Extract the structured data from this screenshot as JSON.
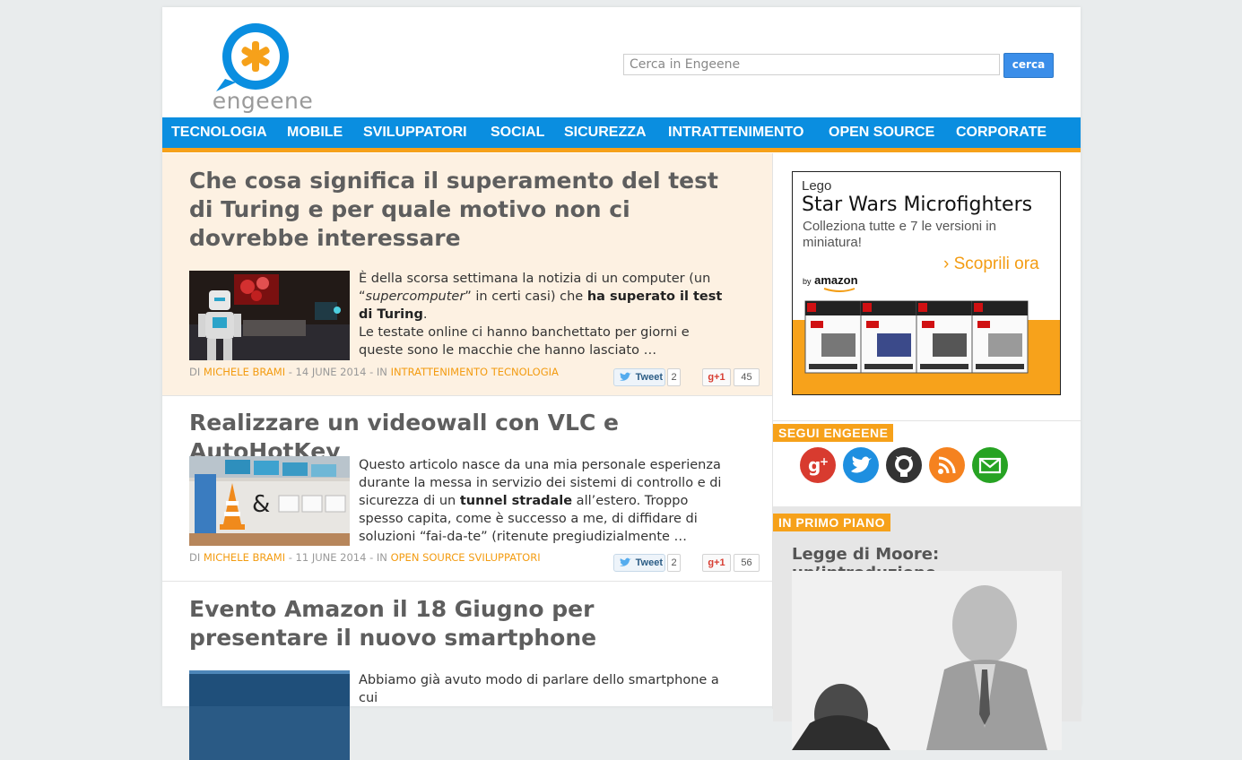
{
  "brand": {
    "name": "engeene",
    "accent": "#0a8ee0",
    "orange": "#f6a11a"
  },
  "search": {
    "placeholder": "Cerca in Engeene",
    "button": "cerca"
  },
  "nav": {
    "items": [
      "TECNOLOGIA",
      "MOBILE",
      "SVILUPPATORI",
      "SOCIAL",
      "SICUREZZA",
      "INTRATTENIMENTO",
      "OPEN SOURCE",
      "CORPORATE"
    ]
  },
  "articles": [
    {
      "title": "Che cosa significa il superamento del test di Turing e per quale motivo non ci dovrebbe interessare",
      "excerpt": [
        "È della scorsa settimana la notizia di un computer (un “",
        "supercomputer",
        "” in certi casi) che ",
        "ha superato il test di Turing",
        ".",
        "Le testate online ci hanno banchettato per giorni e queste sono le macchie che hanno lasciato …"
      ],
      "meta_prefix": "DI ",
      "author": "MICHELE BRAMI",
      "date": " - 14 JUNE 2014 - IN ",
      "categories": "INTRATTENIMENTO TECNOLOGIA",
      "tweet_label": "Tweet",
      "tweet_count": "2",
      "gplus_label": "+1",
      "gplus_count": "45"
    },
    {
      "title": "Realizzare un videowall con VLC e AutoHotKey",
      "excerpt": [
        "Questo articolo nasce da una mia personale esperienza durante la messa in servizio dei sistemi di controllo e di sicurezza di un ",
        "tunnel stradale",
        " all’estero. Troppo spesso capita, come è successo a me, di diffidare di soluzioni “fai-da-te” (ritenute pregiudizialmente …"
      ],
      "meta_prefix": "DI ",
      "author": "MICHELE BRAMI",
      "date": " - 11 JUNE 2014 - IN ",
      "categories": "OPEN SOURCE SVILUPPATORI",
      "tweet_label": "Tweet",
      "tweet_count": "2",
      "gplus_label": "+1",
      "gplus_count": "56"
    },
    {
      "title": "Evento Amazon il 18 Giugno per presentare il nuovo smartphone",
      "excerpt": [
        "Abbiamo già avuto modo di parlare dello smartphone a cui"
      ]
    }
  ],
  "ad": {
    "brand": "Lego",
    "headline": "Star Wars Microfighters",
    "sub": "Colleziona tutte e 7 le versioni in miniatura!",
    "cta": "› Scoprili ora",
    "by": "by",
    "amazon": "amazon",
    "box_label": "STAR WARS",
    "age": "6-12"
  },
  "sidebar": {
    "follow_label": "SEGUI ENGEENE",
    "social": [
      "google-plus",
      "twitter",
      "github",
      "rss",
      "email"
    ],
    "primo_label": "IN PRIMO PIANO",
    "primo_title": "Legge di Moore: un’introduzione"
  }
}
